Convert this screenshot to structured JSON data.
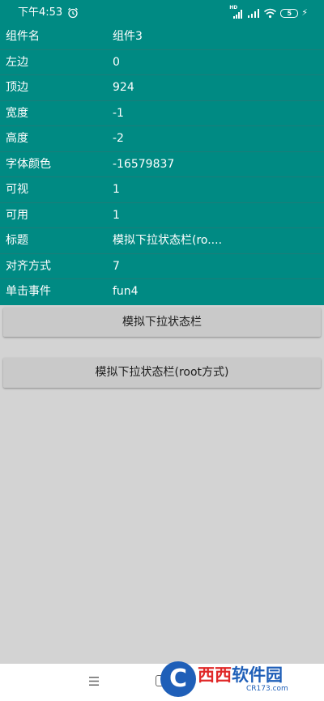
{
  "status_bar": {
    "time": "下午4:53",
    "network_tag": "HD",
    "battery_level": "5",
    "icons": [
      "alarm-icon",
      "signal-icon",
      "signal-icon",
      "wifi-icon",
      "battery-icon",
      "charging-icon"
    ]
  },
  "properties": [
    {
      "name": "组件名",
      "value": "组件3"
    },
    {
      "name": "左边",
      "value": "0"
    },
    {
      "name": "顶边",
      "value": "924"
    },
    {
      "name": "宽度",
      "value": "-1"
    },
    {
      "name": "高度",
      "value": "-2"
    },
    {
      "name": "字体颜色",
      "value": "-16579837"
    },
    {
      "name": "可视",
      "value": "1"
    },
    {
      "name": "可用",
      "value": "1"
    },
    {
      "name": "标题",
      "value": "模拟下拉状态栏(ro...."
    },
    {
      "name": "对齐方式",
      "value": "7"
    },
    {
      "name": "单击事件",
      "value": "fun4"
    }
  ],
  "buttons": {
    "pull_down": "模拟下拉状态栏",
    "pull_down_root": "模拟下拉状态栏(root方式)"
  },
  "nav_bar": {
    "icons": [
      "menu-icon",
      "home-icon"
    ]
  },
  "watermark": {
    "badge": "C",
    "part_a": "西西",
    "part_b": "软件园",
    "sub": "CR173.com"
  },
  "colors": {
    "accent": "#008a83",
    "row_divider": "#1c7d79",
    "background": "#d3d3d3",
    "button": "#c9c9c9",
    "watermark_red": "#e02828",
    "watermark_blue": "#1f5fb8"
  }
}
